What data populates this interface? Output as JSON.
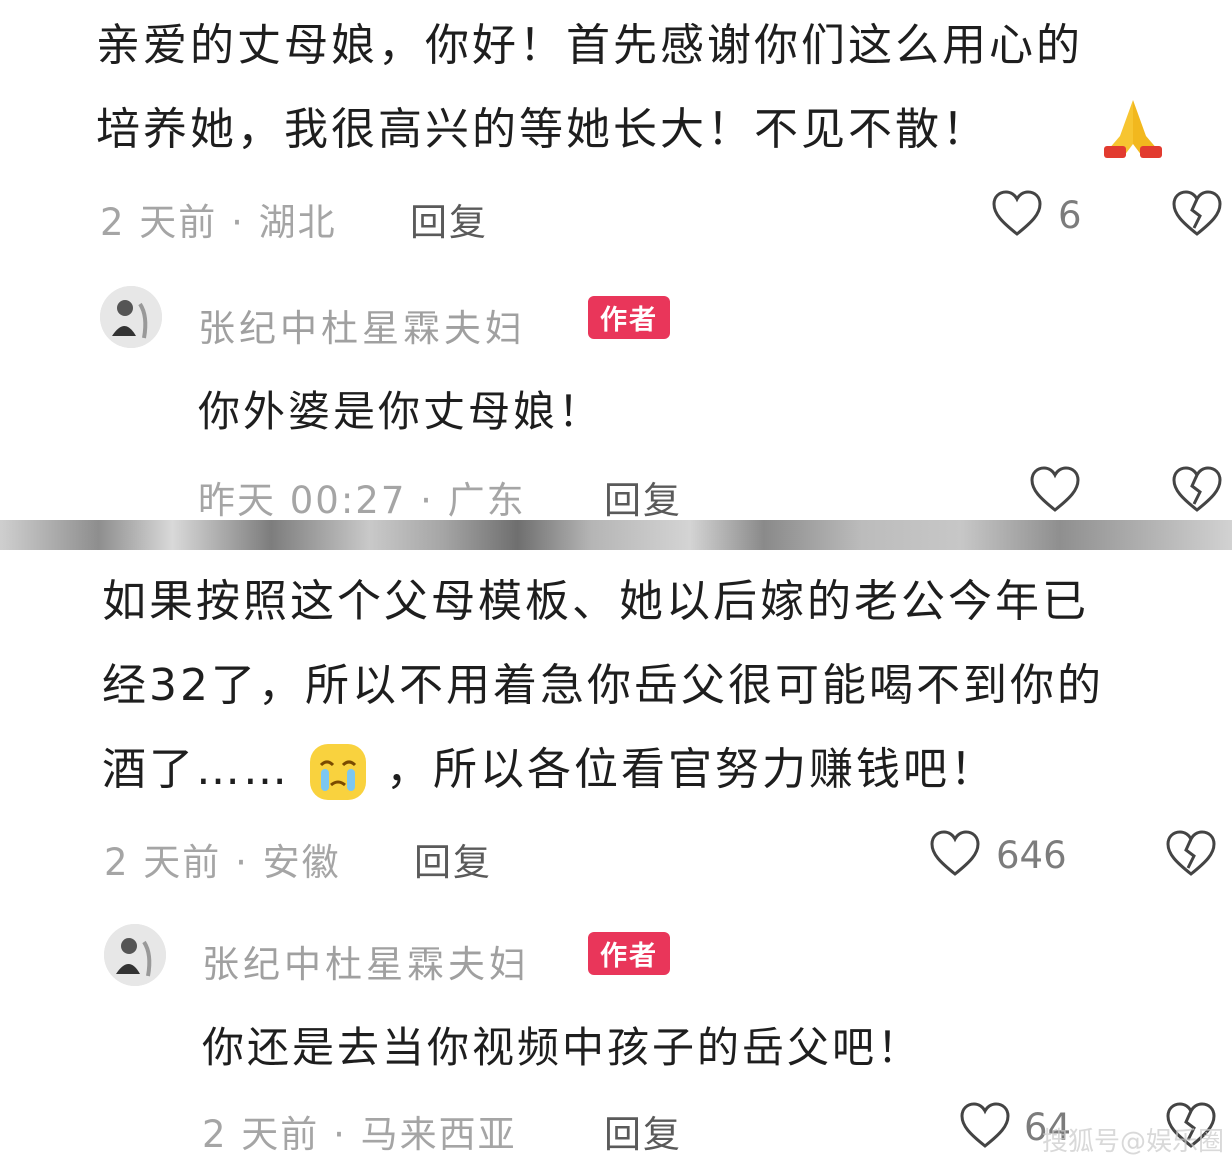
{
  "comments": [
    {
      "lines": [
        "亲爱的丈母娘，你好！首先感谢你们这么用心的",
        "培养她，我很高兴的等她长大！不见不散！"
      ],
      "emoji": "folded-hands",
      "meta": "2 天前 · 湖北",
      "reply": "回复",
      "likes": "6",
      "author_reply": {
        "author": "张纪中杜星霖夫妇",
        "badge": "作者",
        "text": "你外婆是你丈母娘！",
        "meta": "昨天 00:27 · 广东",
        "reply": "回复",
        "likes": ""
      }
    },
    {
      "lines": [
        "如果按照这个父母模板、她以后嫁的老公今年已",
        "经32了，所以不用着急你岳父很可能喝不到你的",
        "酒了……"
      ],
      "line3_tail": "，所以各位看官努力赚钱吧！",
      "emoji": "crying-face",
      "meta": "2 天前 · 安徽",
      "reply": "回复",
      "likes": "646",
      "author_reply": {
        "author": "张纪中杜星霖夫妇",
        "badge": "作者",
        "text": "你还是去当你视频中孩子的岳父吧！",
        "meta": "2 天前 · 马来西亚",
        "reply": "回复",
        "likes": "64"
      }
    }
  ],
  "watermark": "搜狐号@娱乐圈"
}
